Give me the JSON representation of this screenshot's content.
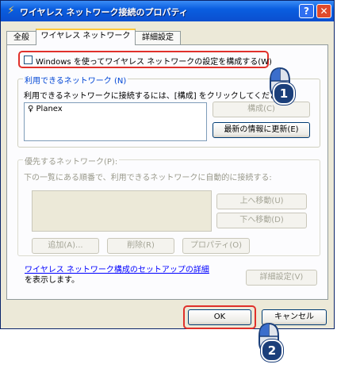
{
  "window": {
    "title": "ワイヤレス ネットワーク接続のプロパティ",
    "help_label": "?",
    "close_label": "✕"
  },
  "tabs": [
    {
      "label": "全般"
    },
    {
      "label": "ワイヤレス ネットワーク"
    },
    {
      "label": "詳細設定"
    }
  ],
  "use_windows_checkbox": {
    "label": "Windows を使ってワイヤレス ネットワークの設定を構成する(W)",
    "checked": false
  },
  "available_networks": {
    "title": "利用できるネットワーク (N)",
    "description": "利用できるネットワークに接続するには、[構成] をクリックしてください",
    "items": [
      "Planex"
    ],
    "configure_button": "構成(C)",
    "refresh_button": "最新の情報に更新(E)"
  },
  "preferred_networks": {
    "title": "優先するネットワーク(P):",
    "description": "下の一覧にある順番で、利用できるネットワークに自動的に接続する:",
    "move_up_button": "上へ移動(U)",
    "move_down_button": "下へ移動(D)",
    "add_button": "追加(A)...",
    "remove_button": "削除(R)",
    "properties_button": "プロパティ(O)"
  },
  "setup_link": {
    "link_text": "ワイヤレス ネットワーク構成のセットアップの詳細",
    "rest_text": "を表示します。"
  },
  "advanced_button": "詳細設定(V)",
  "ok_button": "OK",
  "cancel_button": "キャンセル",
  "step_badges": {
    "step1": "1",
    "step2": "2"
  },
  "colors": {
    "title_bar": "#0b5ee0",
    "highlight": "#e0312b",
    "link": "#0000ff",
    "badge": "#1b3f7a"
  }
}
